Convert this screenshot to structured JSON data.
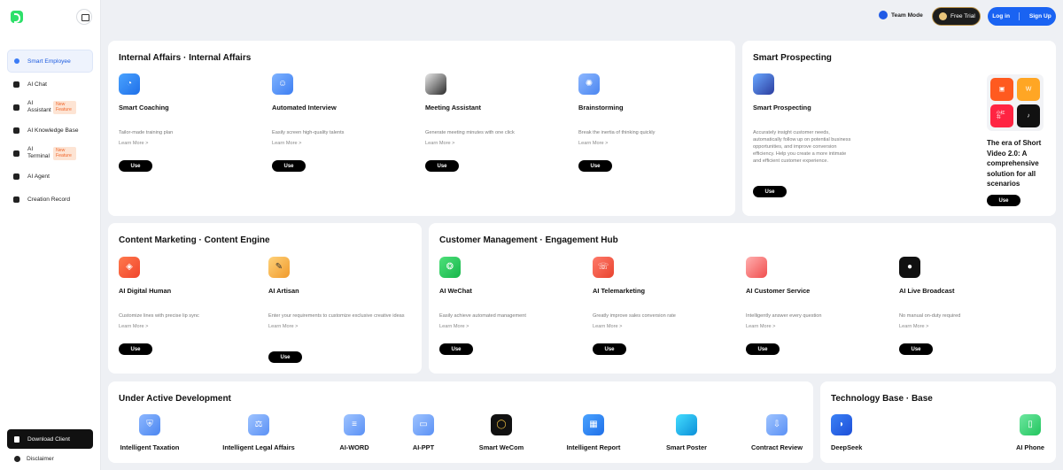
{
  "sidebar": {
    "items": [
      {
        "label": "Smart Employee"
      },
      {
        "label": "AI Chat"
      },
      {
        "label": "AI Assistant",
        "badge": "New Feature"
      },
      {
        "label": "AI Knowledge Base"
      },
      {
        "label": "AI Terminal",
        "badge": "New Feature"
      },
      {
        "label": "AI Agent"
      },
      {
        "label": "Creation Record"
      }
    ],
    "download_label": "Download Client",
    "disclaimer_label": "Disclaimer"
  },
  "topbar": {
    "team_mode": "Team Mode",
    "free_trial": "Free Trial",
    "login": "Log in",
    "signup": "Sign Up"
  },
  "use_label": "Use",
  "learn_more": "Learn More >",
  "internal": {
    "title": "Internal Affairs · Internal Affairs",
    "features": [
      {
        "name": "Smart Coaching",
        "desc": "Tailor-made training plan"
      },
      {
        "name": "Automated Interview",
        "desc": "Easily screen high-quality talents"
      },
      {
        "name": "Meeting Assistant",
        "desc": "Generate meeting minutes with one click"
      },
      {
        "name": "Brainstorming",
        "desc": "Break the inertia of thinking quickly"
      }
    ]
  },
  "prospecting": {
    "title": "Smart Prospecting",
    "feature": {
      "name": "Smart Prospecting",
      "desc": "Accurately insight customer needs, automatically follow up on potential business opportunities, and improve conversion efficiency. Help you create a more intimate and efficient customer experience."
    },
    "promo": "The era of Short Video 2.0: A comprehensive solution for all scenarios",
    "apps": [
      {
        "icon": "kuaishou-icon",
        "glyph": "",
        "color": "#ff5a1f"
      },
      {
        "icon": "weishi-icon",
        "glyph": "W",
        "color": "#ffa624"
      },
      {
        "icon": "xiaohongshu-icon",
        "glyph": "小红书",
        "color": "#ff2442"
      },
      {
        "icon": "tiktok-icon",
        "glyph": "♪",
        "color": "#111111"
      }
    ]
  },
  "content": {
    "title": "Content Marketing · Content Engine",
    "features": [
      {
        "name": "AI Digital Human",
        "desc": "Customize lines with precise lip sync"
      },
      {
        "name": "AI Artisan",
        "desc": "Enter your requirements to customize exclusive creative ideas"
      }
    ]
  },
  "customer": {
    "title": "Customer Management · Engagement Hub",
    "features": [
      {
        "name": "AI WeChat",
        "desc": "Easily achieve automated management"
      },
      {
        "name": "AI Telemarketing",
        "desc": "Greatly improve sales conversion rate"
      },
      {
        "name": "AI Customer Service",
        "desc": "Intelligently answer every question"
      },
      {
        "name": "AI Live Broadcast",
        "desc": "No manual on-duty required"
      }
    ]
  },
  "development": {
    "title": "Under Active Development",
    "items": [
      {
        "name": "Intelligent Taxation"
      },
      {
        "name": "Intelligent Legal Affairs"
      },
      {
        "name": "AI-WORD"
      },
      {
        "name": "AI-PPT"
      },
      {
        "name": "Smart WeCom"
      },
      {
        "name": "Intelligent Report"
      },
      {
        "name": "Smart Poster"
      },
      {
        "name": "Contract Review"
      }
    ]
  },
  "tech": {
    "title": "Technology Base · Base",
    "items": [
      {
        "name": "DeepSeek"
      },
      {
        "name": "AI Phone"
      }
    ]
  }
}
